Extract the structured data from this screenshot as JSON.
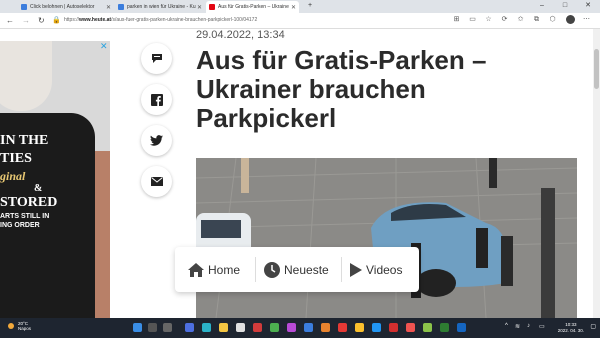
{
  "browser": {
    "tabs": [
      {
        "label": "Click belohnen | Autoselektor",
        "color": "#3b7ddd"
      },
      {
        "label": "parken in wien für Ukraine - Ku",
        "color": "#3b7ddd"
      },
      {
        "label": "Aus für Gratis-Parken – Ukraine",
        "color": "#e30613"
      }
    ],
    "new_tab": "+",
    "url_prefix": "https://",
    "url_domain": "www.heute.at",
    "url_path": "/s/aus-fuer-gratis-parken-ukraine-brauchen-parkpickerl-100/04172",
    "window": {
      "minimize": "–",
      "maximize": "□",
      "close": "✕"
    }
  },
  "ad": {
    "lines": [
      "IN THE",
      "TIES",
      "ginal",
      "&",
      "STORED",
      "ARTS STILL IN",
      "ING ORDER"
    ],
    "close": "✕"
  },
  "article": {
    "date": "29.04.2022, 13:34",
    "title": "Aus für Gratis-Parken – Ukrainer brauchen Parkpickerl"
  },
  "share_icons": [
    "comment-icon",
    "facebook-icon",
    "twitter-icon",
    "mail-icon"
  ],
  "bottom_nav": {
    "home": "Home",
    "news": "Neueste",
    "videos": "Videos"
  },
  "taskbar": {
    "temperature": "20°C",
    "weather": "Napos",
    "time": "10:33",
    "date": "2022. 04. 30."
  },
  "colors": {
    "brand": "#e30613",
    "title": "#2b2b2b",
    "taskbar": "#1e2530"
  }
}
